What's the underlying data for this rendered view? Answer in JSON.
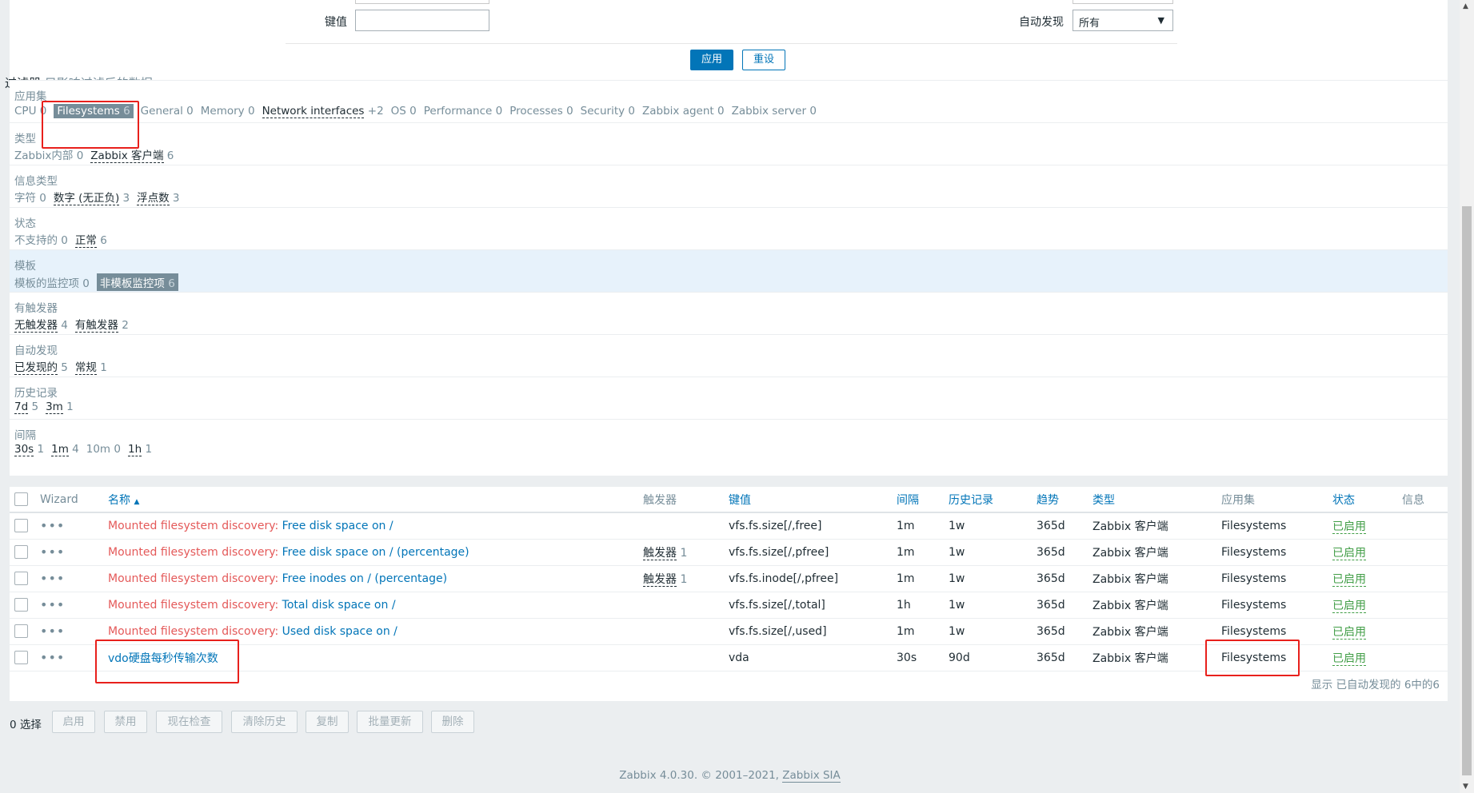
{
  "filter_form": {
    "key_label": "键值",
    "key_value": "",
    "discovery_label": "自动发现",
    "discovery_value": "所有",
    "apply_label": "应用",
    "reset_label": "重设"
  },
  "subfilter": {
    "title": "过滤器",
    "note": "只影响过滤后的数据",
    "groups": [
      {
        "label": "应用集",
        "items": [
          {
            "name": "CPU",
            "count": "0",
            "selected": false,
            "link": false
          },
          {
            "name": "Filesystems",
            "count": "6",
            "selected": true,
            "link": true
          },
          {
            "name": "General",
            "count": "0",
            "selected": false,
            "link": false
          },
          {
            "name": "Memory",
            "count": "0",
            "selected": false,
            "link": false
          },
          {
            "name": "Network interfaces",
            "count": "+2",
            "selected": false,
            "link": true
          },
          {
            "name": "OS",
            "count": "0",
            "selected": false,
            "link": false
          },
          {
            "name": "Performance",
            "count": "0",
            "selected": false,
            "link": false
          },
          {
            "name": "Processes",
            "count": "0",
            "selected": false,
            "link": false
          },
          {
            "name": "Security",
            "count": "0",
            "selected": false,
            "link": false
          },
          {
            "name": "Zabbix agent",
            "count": "0",
            "selected": false,
            "link": false
          },
          {
            "name": "Zabbix server",
            "count": "0",
            "selected": false,
            "link": false
          }
        ]
      },
      {
        "label": "类型",
        "items": [
          {
            "name": "Zabbix内部",
            "count": "0",
            "selected": false,
            "link": false
          },
          {
            "name": "Zabbix 客户端",
            "count": "6",
            "selected": false,
            "link": true
          }
        ]
      },
      {
        "label": "信息类型",
        "items": [
          {
            "name": "字符",
            "count": "0",
            "selected": false,
            "link": false
          },
          {
            "name": "数字 (无正负)",
            "count": "3",
            "selected": false,
            "link": true
          },
          {
            "name": "浮点数",
            "count": "3",
            "selected": false,
            "link": true
          }
        ]
      },
      {
        "label": "状态",
        "items": [
          {
            "name": "不支持的",
            "count": "0",
            "selected": false,
            "link": false
          },
          {
            "name": "正常",
            "count": "6",
            "selected": false,
            "link": true
          }
        ]
      },
      {
        "label": "模板",
        "highlight": true,
        "items": [
          {
            "name": "模板的监控项",
            "count": "0",
            "selected": false,
            "link": false
          },
          {
            "name": "非模板监控项",
            "count": "6",
            "selected": true,
            "link": true
          }
        ]
      },
      {
        "label": "有触发器",
        "items": [
          {
            "name": "无触发器",
            "count": "4",
            "selected": false,
            "link": true
          },
          {
            "name": "有触发器",
            "count": "2",
            "selected": false,
            "link": true
          }
        ]
      },
      {
        "label": "自动发现",
        "items": [
          {
            "name": "已发现的",
            "count": "5",
            "selected": false,
            "link": true
          },
          {
            "name": "常规",
            "count": "1",
            "selected": false,
            "link": true
          }
        ]
      },
      {
        "label": "历史记录",
        "items": [
          {
            "name": "7d",
            "count": "5",
            "selected": false,
            "link": true
          },
          {
            "name": "3m",
            "count": "1",
            "selected": false,
            "link": true
          }
        ]
      },
      {
        "label": "间隔",
        "items": [
          {
            "name": "30s",
            "count": "1",
            "selected": false,
            "link": true
          },
          {
            "name": "1m",
            "count": "4",
            "selected": false,
            "link": true
          },
          {
            "name": "10m",
            "count": "0",
            "selected": false,
            "link": false
          },
          {
            "name": "1h",
            "count": "1",
            "selected": false,
            "link": true
          }
        ]
      }
    ]
  },
  "table": {
    "headers": {
      "wizard": "Wizard",
      "name": "名称",
      "name_sort_icon": "sort-asc-icon",
      "triggers": "触发器",
      "key": "键值",
      "interval": "间隔",
      "history": "历史记录",
      "trends": "趋势",
      "type": "类型",
      "applications": "应用集",
      "status": "状态",
      "info": "信息"
    },
    "rows": [
      {
        "prefix": "Mounted filesystem discovery",
        "name": "Free disk space on /",
        "trigger": "",
        "trigger_count": "",
        "key": "vfs.fs.size[/,free]",
        "interval": "1m",
        "history": "1w",
        "trends": "365d",
        "type": "Zabbix 客户端",
        "applications": "Filesystems",
        "status": "已启用"
      },
      {
        "prefix": "Mounted filesystem discovery",
        "name": "Free disk space on / (percentage)",
        "trigger": "触发器",
        "trigger_count": "1",
        "key": "vfs.fs.size[/,pfree]",
        "interval": "1m",
        "history": "1w",
        "trends": "365d",
        "type": "Zabbix 客户端",
        "applications": "Filesystems",
        "status": "已启用"
      },
      {
        "prefix": "Mounted filesystem discovery",
        "name": "Free inodes on / (percentage)",
        "trigger": "触发器",
        "trigger_count": "1",
        "key": "vfs.fs.inode[/,pfree]",
        "interval": "1m",
        "history": "1w",
        "trends": "365d",
        "type": "Zabbix 客户端",
        "applications": "Filesystems",
        "status": "已启用"
      },
      {
        "prefix": "Mounted filesystem discovery",
        "name": "Total disk space on /",
        "trigger": "",
        "trigger_count": "",
        "key": "vfs.fs.size[/,total]",
        "interval": "1h",
        "history": "1w",
        "trends": "365d",
        "type": "Zabbix 客户端",
        "applications": "Filesystems",
        "status": "已启用"
      },
      {
        "prefix": "Mounted filesystem discovery",
        "name": "Used disk space on /",
        "trigger": "",
        "trigger_count": "",
        "key": "vfs.fs.size[/,used]",
        "interval": "1m",
        "history": "1w",
        "trends": "365d",
        "type": "Zabbix 客户端",
        "applications": "Filesystems",
        "status": "已启用"
      },
      {
        "prefix": "",
        "name": "vdo硬盘每秒传输次数",
        "trigger": "",
        "trigger_count": "",
        "key": "vda",
        "interval": "30s",
        "history": "90d",
        "trends": "365d",
        "type": "Zabbix 客户端",
        "applications": "Filesystems",
        "status": "已启用"
      }
    ],
    "footer": "显示 已自动发现的 6中的6"
  },
  "actions": {
    "selected_count": "0 选择",
    "buttons": [
      "启用",
      "禁用",
      "现在检查",
      "清除历史",
      "复制",
      "批量更新",
      "删除"
    ]
  },
  "footer": {
    "text": "Zabbix 4.0.30. © 2001–2021,",
    "company": "Zabbix SIA"
  },
  "colors": {
    "accent": "#0275b8",
    "discovery_prefix": "#e45959",
    "enabled": "#429e47",
    "muted": "#768d99",
    "annotation": "#e8201c"
  }
}
